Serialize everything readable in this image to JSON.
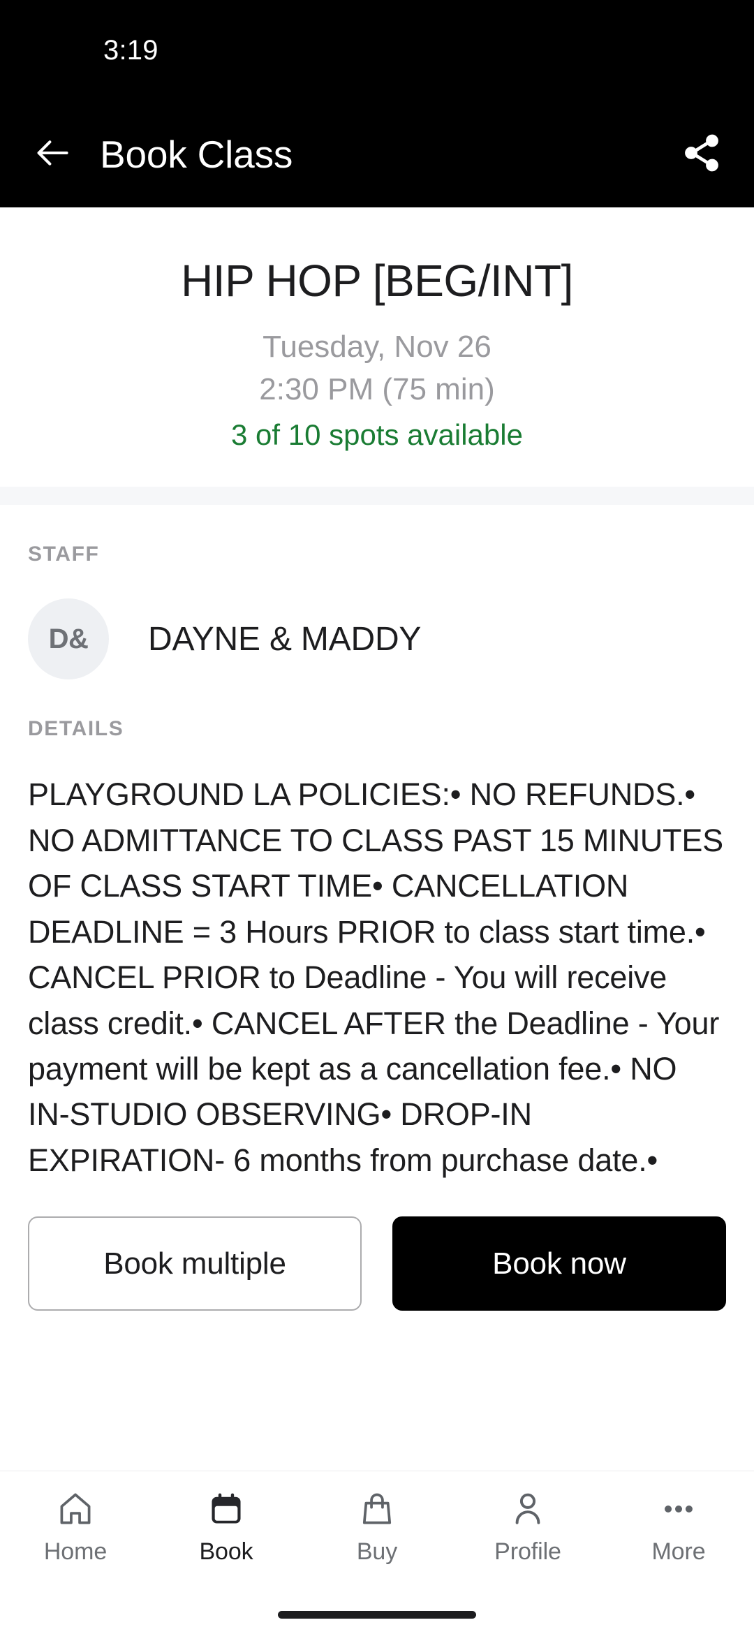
{
  "status_bar": {
    "time": "3:19"
  },
  "app_bar": {
    "title": "Book Class",
    "back_icon": "arrow-left-icon",
    "share_icon": "share-icon"
  },
  "class": {
    "title": "HIP HOP [BEG/INT]",
    "date": "Tuesday, Nov 26",
    "time": "2:30 PM (75 min)",
    "availability": "3 of 10 spots available",
    "availability_color": "#1a7c33",
    "spots_open": 3,
    "spots_total": 10
  },
  "staff_section": {
    "label": "STAFF",
    "avatar_initials": "D&",
    "name": "DAYNE & MADDY"
  },
  "details_section": {
    "label": "DETAILS",
    "body": "PLAYGROUND LA POLICIES:• NO REFUNDS.• NO ADMITTANCE TO CLASS PAST 15 MINUTES OF CLASS START TIME• CANCELLATION DEADLINE = 3 Hours PRIOR to class start time.• CANCEL PRIOR to Deadline - You will receive class credit.• CANCEL AFTER the Deadline - Your payment will be kept as a cancellation fee.• NO IN-STUDIO OBSERVING• DROP-IN EXPIRATION- 6 months from purchase date.•"
  },
  "actions": {
    "secondary_label": "Book multiple",
    "primary_label": "Book now"
  },
  "bottom_nav": {
    "items": [
      {
        "label": "Home",
        "icon": "home-icon",
        "active": false
      },
      {
        "label": "Book",
        "icon": "calendar-icon",
        "active": true
      },
      {
        "label": "Buy",
        "icon": "shopping-bag-icon",
        "active": false
      },
      {
        "label": "Profile",
        "icon": "person-icon",
        "active": false
      },
      {
        "label": "More",
        "icon": "ellipsis-icon",
        "active": false
      }
    ]
  },
  "colors": {
    "header_background": "#000000",
    "accent_green": "#1a7c33",
    "primary_button": "#000000",
    "muted_text": "#9a9a9e",
    "divider": "#f6f7f9"
  }
}
